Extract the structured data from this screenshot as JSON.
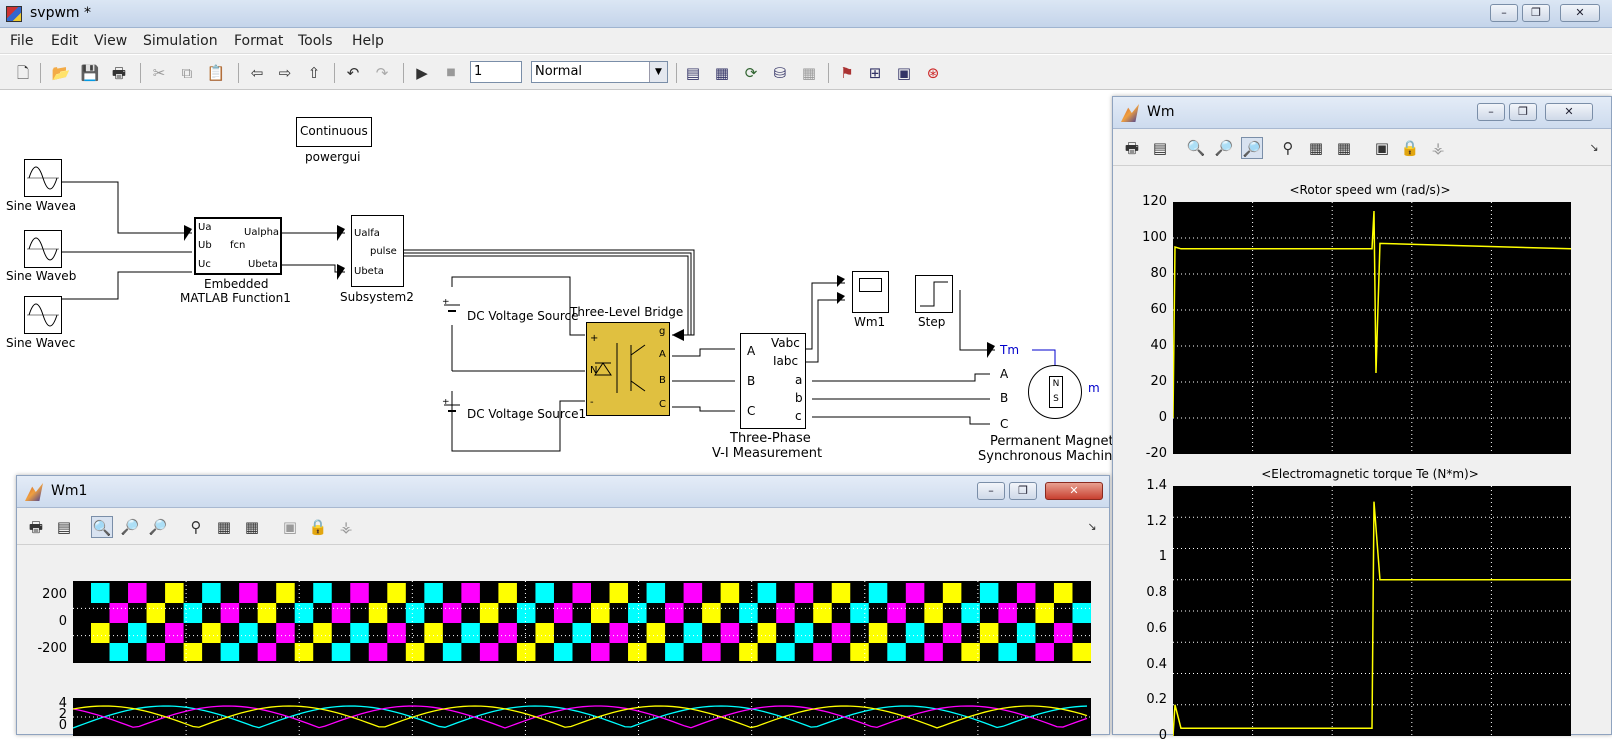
{
  "window": {
    "title": "svpwm *",
    "min": "–",
    "max": "❐",
    "close": "✕"
  },
  "menus": [
    "File",
    "Edit",
    "View",
    "Simulation",
    "Format",
    "Tools",
    "Help"
  ],
  "toolbar": {
    "stop_time": "1",
    "sim_mode": "Normal"
  },
  "icons": [
    "new-icon",
    "open-icon",
    "save-icon",
    "print-icon",
    "cut-icon",
    "copy-icon",
    "paste-icon",
    "back-icon",
    "forward-icon",
    "up-icon",
    "undo-icon",
    "redo-icon",
    "play-icon",
    "stop-icon",
    "library-icon",
    "explorer-icon",
    "model-icon",
    "debug-icon",
    "profile-icon",
    "build-icon",
    "scope-icon",
    "config-icon",
    "help-icon"
  ],
  "model": {
    "powergui": {
      "text": "Continuous",
      "label": "powergui"
    },
    "sine_a": "Sine Wavea",
    "sine_b": "Sine Waveb",
    "sine_c": "Sine Wavec",
    "emf": {
      "label1": "Embedded",
      "label2": "MATLAB Function1",
      "in1": "Ua",
      "in2": "Ub",
      "in3": "Uc",
      "out1": "Ualpha",
      "out2": "Ubeta",
      "name": "fcn"
    },
    "subsys": {
      "label": "Subsystem2",
      "in1": "Ualfa",
      "in2": "Ubeta",
      "out1": "pulse"
    },
    "dc1": "DC Voltage Source",
    "dc2": "DC Voltage Source1",
    "bridge": {
      "label": "Three-Level Bridge",
      "g": "g",
      "a": "A",
      "b": "B",
      "c": "C",
      "p": "+",
      "n": "N",
      "m": "-"
    },
    "vim": {
      "label1": "Three-Phase",
      "label2": "V-I Measurement",
      "A": "A",
      "B": "B",
      "C": "C",
      "vabc": "Vabc",
      "iabc": "Iabc",
      "a": "a",
      "b": "b",
      "c": "c"
    },
    "scope": "Wm1",
    "step": "Step",
    "pmsm": {
      "label1": "Permanent Magnet",
      "label2": "Synchronous Machine",
      "tm": "Tm",
      "A": "A",
      "B": "B",
      "C": "C",
      "m": "m",
      "N": "N",
      "S": "S"
    }
  },
  "fig_wm": {
    "title": "Wm",
    "plot1": {
      "title": "<Rotor speed wm (rad/s)>",
      "yticks": [
        "120",
        "100",
        "80",
        "60",
        "40",
        "20",
        "0",
        "-20"
      ]
    },
    "plot2": {
      "title": "<Electromagnetic torque Te (N*m)>",
      "yticks": [
        "1.4",
        "1.2",
        "1",
        "0.8",
        "0.6",
        "0.4",
        "0.2",
        "0"
      ]
    }
  },
  "fig_wm1": {
    "title": "Wm1",
    "plot1": {
      "yticks": [
        "200",
        "0",
        "-200"
      ]
    },
    "plot2": {
      "yticks": [
        "4",
        "2",
        "0"
      ]
    }
  },
  "chart_data": [
    {
      "type": "line",
      "title": "<Rotor speed wm (rad/s)>",
      "ylim": [
        -20,
        120
      ],
      "series": [
        {
          "x": [
            0,
            0.005,
            0.02,
            0.5,
            0.505,
            0.51,
            0.52,
            1.0
          ],
          "values": [
            0,
            95,
            94,
            94,
            115,
            25,
            97,
            94
          ]
        }
      ],
      "grid": true,
      "color": "#ffff00"
    },
    {
      "type": "line",
      "title": "<Electromagnetic torque Te (N*m)>",
      "ylim": [
        0,
        1.6
      ],
      "series": [
        {
          "x": [
            0,
            0.005,
            0.02,
            0.5,
            0.505,
            0.52,
            1.0
          ],
          "values": [
            0,
            0.2,
            0.05,
            0.05,
            1.5,
            1.0,
            1.0
          ]
        }
      ],
      "grid": true,
      "color": "#ffff00"
    },
    {
      "type": "line",
      "title": "",
      "ylim": [
        -300,
        300
      ],
      "series": [],
      "grid": true
    },
    {
      "type": "line",
      "title": "",
      "ylim": [
        0,
        4
      ],
      "series": [],
      "grid": true
    }
  ],
  "colors": {
    "scope_bg": "#000000",
    "trace_y": "#ffff00",
    "trace_c": "#00ffff",
    "trace_m": "#ff00ff",
    "bridge": "#e0c040"
  }
}
